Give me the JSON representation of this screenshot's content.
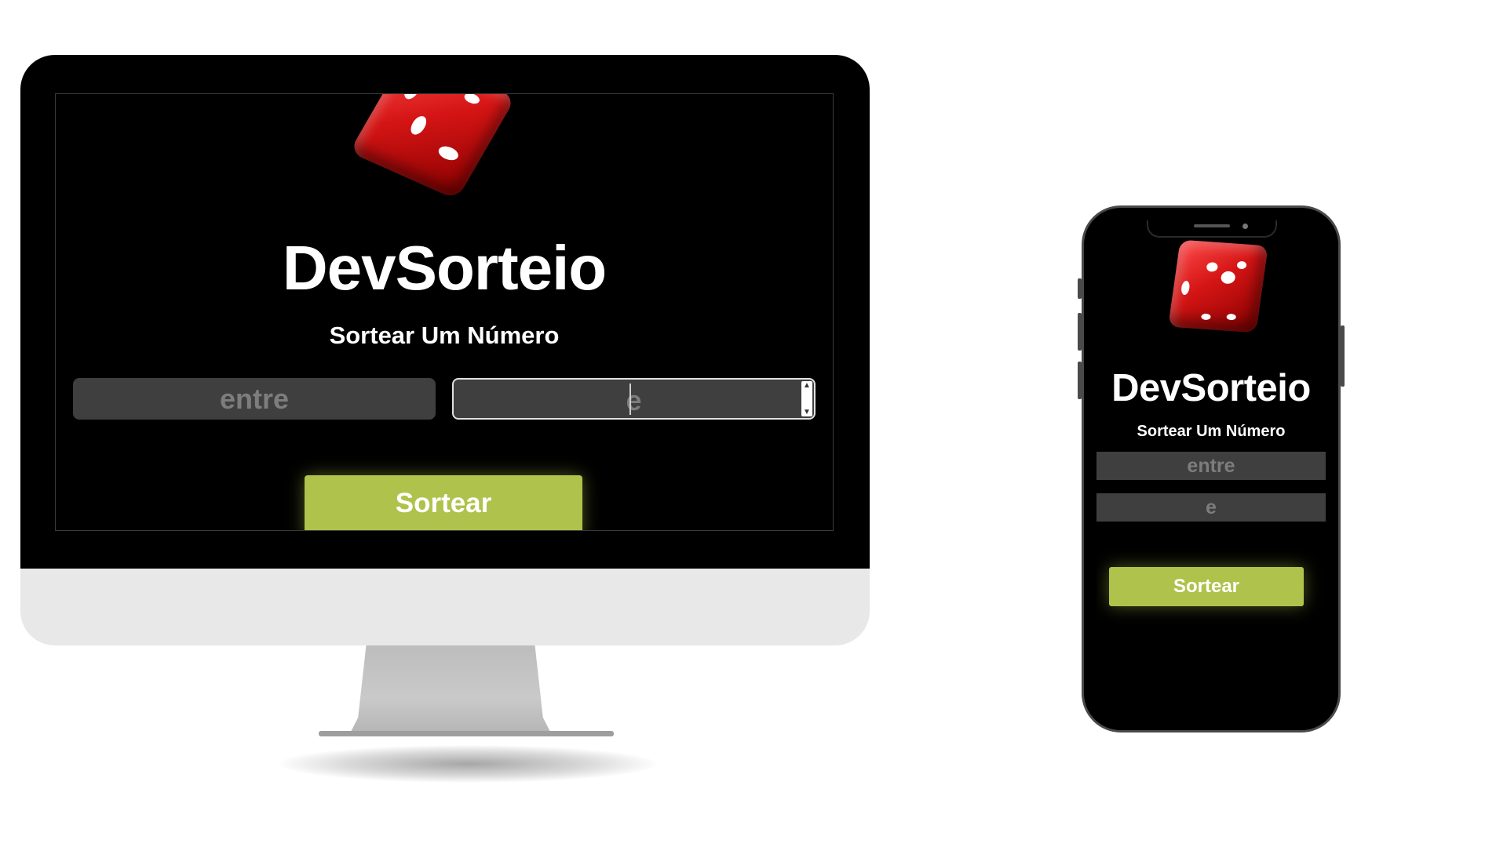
{
  "app": {
    "title": "DevSorteio",
    "subtitle": "Sortear Um Número"
  },
  "form": {
    "min_placeholder": "entre",
    "max_placeholder": "e",
    "submit_label": "Sortear"
  },
  "colors": {
    "background": "#000000",
    "accent": "#afc24c",
    "field_bg": "#3f3f3f",
    "die_red": "#d41414"
  },
  "icons": {
    "logo": "red-dice-icon",
    "spinner": "number-spinner-icon"
  }
}
